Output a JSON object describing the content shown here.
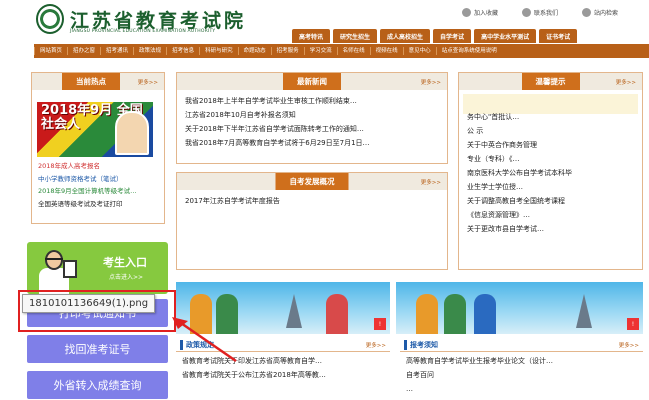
{
  "header": {
    "title": "江苏省教育考试院",
    "subtitle": "JIANGSU PROVINCIAL EDUCATION EXAMINATION AUTHORITY",
    "top_links": [
      "加入收藏",
      "联系我们",
      "站内检索"
    ],
    "tabs": [
      "高考特讯",
      "研究生招生",
      "成人高校招生",
      "自学考试",
      "高中学业水平测试",
      "证书考试"
    ]
  },
  "nav": {
    "items": [
      "网站首页",
      "招办之窗",
      "招考通讯",
      "政策法规",
      "招考信息",
      "科研与研究",
      "命题动态",
      "招考服务",
      "学习交流",
      "名师在线",
      "视频在线",
      "意见中心",
      "站点查询系统使用说明"
    ]
  },
  "hot": {
    "title": "当前热点",
    "more": "更多>>",
    "image_text": "2018年9月 全国 社会人",
    "items": [
      {
        "text": "2018年成人高考报名",
        "color": "#d03030"
      },
      {
        "text": "中小学教师资格考试（笔试）",
        "color": "#1e5aa8"
      },
      {
        "text": "2018年9月全国计算机等级考试…",
        "color": "#2a8a3a"
      },
      {
        "text": "全国英语等级考试及考证打印",
        "color": "#222222"
      }
    ]
  },
  "latest_news": {
    "title": "最新新闻",
    "more": "更多>>",
    "items": [
      "我省2018年上半年自学考试毕业生审核工作顺利结束…",
      "江苏省2018年10月自考补报名须知",
      "关于2018年下半年江苏省自学考试面陈转考工作的通知…",
      "我省2018年7月高等教育自学考试将于6月29日至7月1日…"
    ]
  },
  "dev_report": {
    "title": "自考发展概况",
    "more": "更多>>",
    "items": [
      "2017年江苏自学考试年度报告"
    ]
  },
  "tips": {
    "title": "温馨提示",
    "more": "更多>>",
    "lines": [
      "务中心\"首批认…",
      "公 示",
      "关于中英合作商务管理",
      "专业（专科）《…",
      "南京医科大学公布自学考试本科毕",
      "业生学士学位授…",
      "关于调整高教自考全国统考课程",
      "《信息资源管理》…",
      "关于更改市县自学考试…"
    ]
  },
  "entry": {
    "title": "考生入口",
    "sub": "点击进入>>"
  },
  "buttons": [
    "打印考试通知书",
    "找回准考证号",
    "外省转入成绩查询"
  ],
  "policy": {
    "title": "政策规定",
    "more": "更多>>",
    "items": [
      "省教育考试院关于印发江苏省高等教育自学…",
      "省教育考试院关于公布江苏省2018年高等教…"
    ]
  },
  "exam_notice": {
    "title": "报考须知",
    "more": "更多>>",
    "items": [
      "高等教育自学考试毕业生报考毕业论文（设计…",
      "自考百问",
      "…"
    ]
  },
  "tooltip": {
    "filename": "1810101136649(1).png"
  },
  "colors": {
    "brand_green": "#1c5f2e",
    "nav_orange": "#b86018",
    "panel_orange": "#cf6f1c",
    "entry_green": "#86c93f",
    "button_purple": "#7f7fe8",
    "highlight_red": "#e02020"
  }
}
